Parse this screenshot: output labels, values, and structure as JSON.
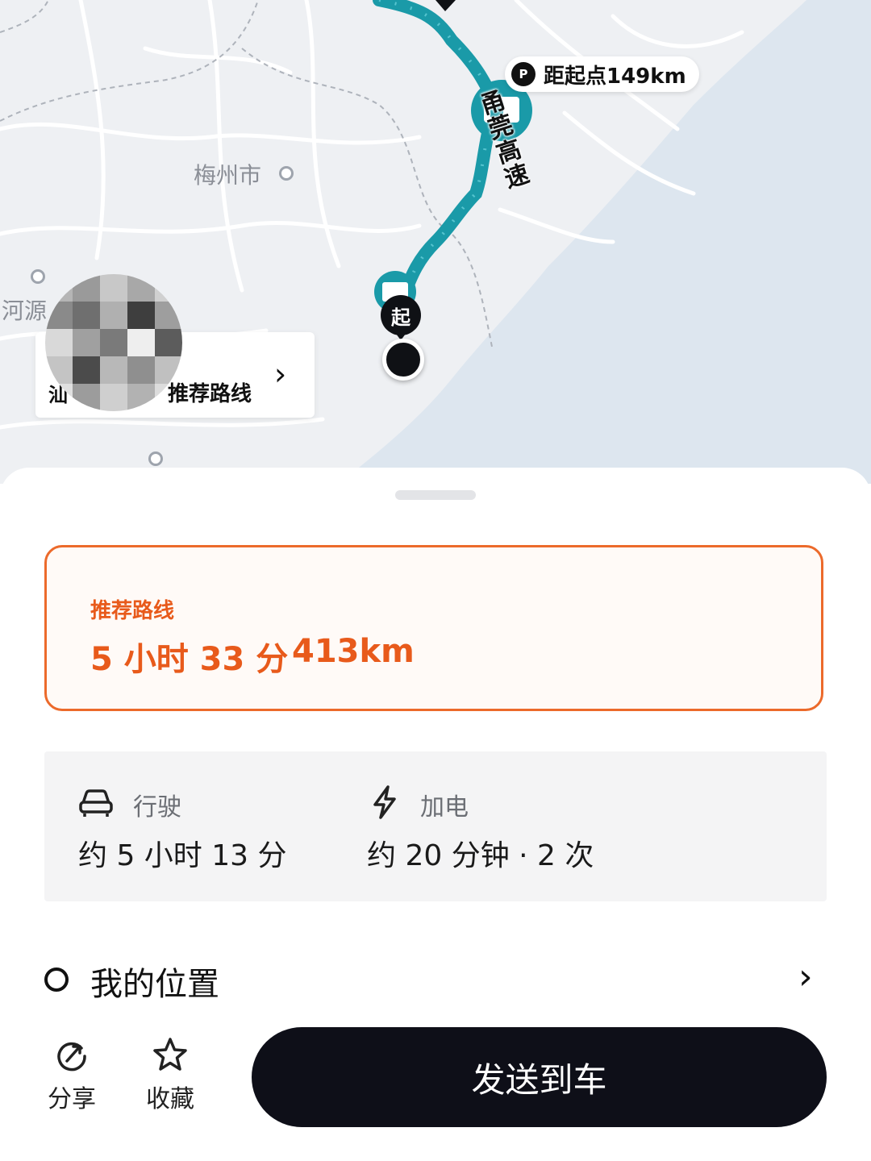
{
  "map": {
    "cities": {
      "meizhou": "梅州市",
      "heyuan": "河源"
    },
    "distance_callout": {
      "icon": "parking-charger-icon",
      "text": "距起点149km"
    },
    "highway_label": "甬莞高速",
    "route_card": {
      "left_text": "汕",
      "label": "推荐路线"
    },
    "start_pin": "起",
    "route_color": "#1a9aa8"
  },
  "sheet": {
    "recommended": {
      "title": "推荐路线",
      "time": "5 小时 33 分",
      "distance": "413km",
      "accent": "#e85a1b"
    },
    "stats": {
      "driving": {
        "icon": "car-icon",
        "label": "行驶",
        "value": "约 5 小时 13 分"
      },
      "charging": {
        "icon": "lightning-icon",
        "label": "加电",
        "value": "约 20 分钟 · 2 次"
      }
    },
    "origin": {
      "label": "我的位置"
    },
    "actions": {
      "share": "分享",
      "favorite": "收藏"
    },
    "send_button": "发送到车"
  }
}
